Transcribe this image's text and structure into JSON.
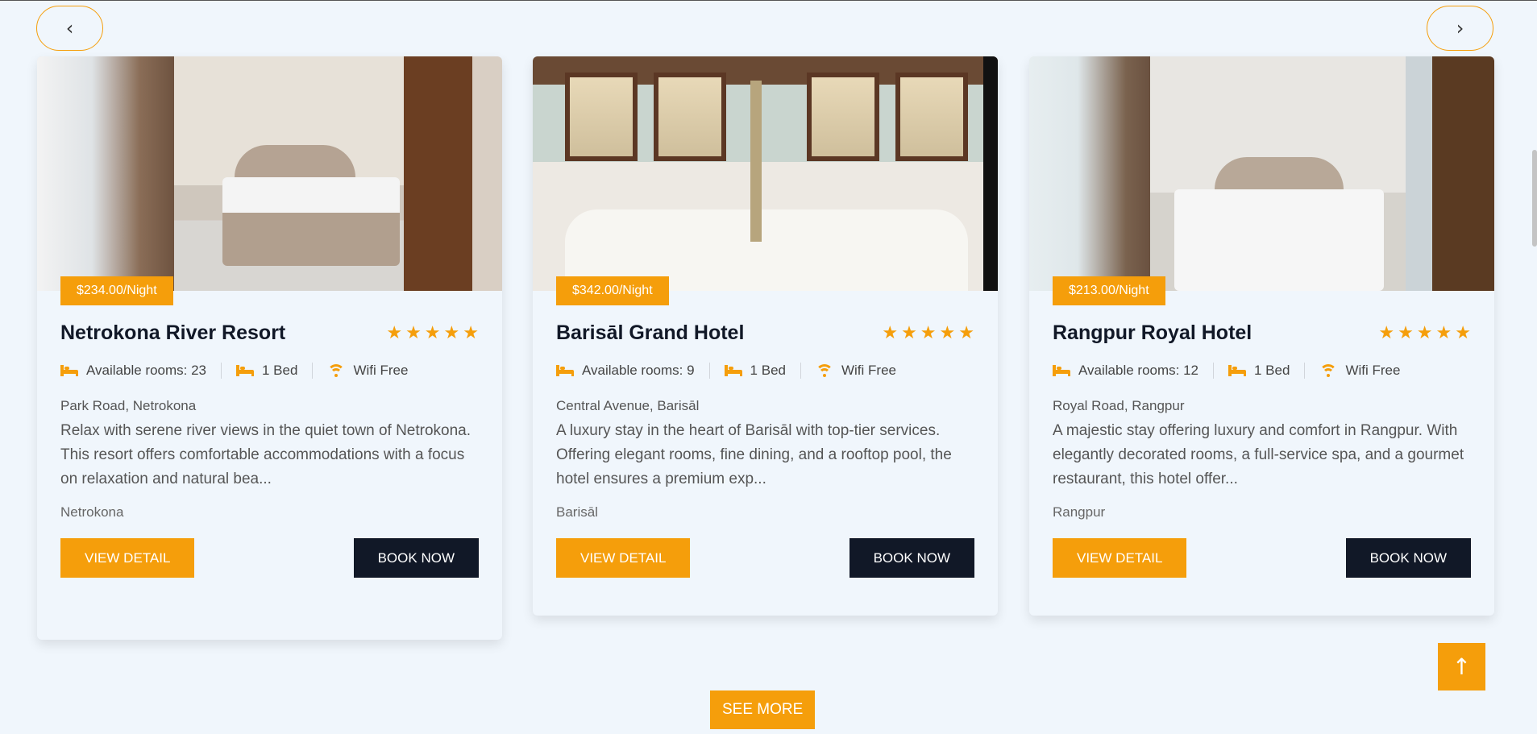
{
  "carousel": {
    "prev_icon": "‹",
    "next_icon": "›"
  },
  "hotels": [
    {
      "price": "$234.00/Night",
      "name": "Netrokona River Resort",
      "rating_stars": 5,
      "rooms_label": "Available rooms: 23",
      "bed_label": "1 Bed",
      "wifi_label": "Wifi Free",
      "address": "Park Road, Netrokona",
      "description": "Relax with serene river views in the quiet town of Netrokona. This resort offers comfortable accommodations with a focus on relaxation and natural bea...",
      "city": "Netrokona",
      "detail_label": "VIEW DETAIL",
      "book_label": "BOOK NOW"
    },
    {
      "price": "$342.00/Night",
      "name": "Barisāl Grand Hotel",
      "rating_stars": 5,
      "rooms_label": "Available rooms: 9",
      "bed_label": "1 Bed",
      "wifi_label": "Wifi Free",
      "address": "Central Avenue, Barisāl",
      "description": "A luxury stay in the heart of Barisāl with top-tier services. Offering elegant rooms, fine dining, and a rooftop pool, the hotel ensures a premium exp...",
      "city": "Barisāl",
      "detail_label": "VIEW DETAIL",
      "book_label": "BOOK NOW"
    },
    {
      "price": "$213.00/Night",
      "name": "Rangpur Royal Hotel",
      "rating_stars": 5,
      "rooms_label": "Available rooms: 12",
      "bed_label": "1 Bed",
      "wifi_label": "Wifi Free",
      "address": "Royal Road, Rangpur",
      "description": "A majestic stay offering luxury and comfort in Rangpur. With elegantly decorated rooms, a full-service spa, and a gourmet restaurant, this hotel offer...",
      "city": "Rangpur",
      "detail_label": "VIEW DETAIL",
      "book_label": "BOOK NOW"
    }
  ],
  "see_more_label": "SEE MORE",
  "scroll_top_icon": "↑",
  "colors": {
    "accent": "#f59e0b",
    "dark": "#111827",
    "background": "#f0f6fc"
  }
}
